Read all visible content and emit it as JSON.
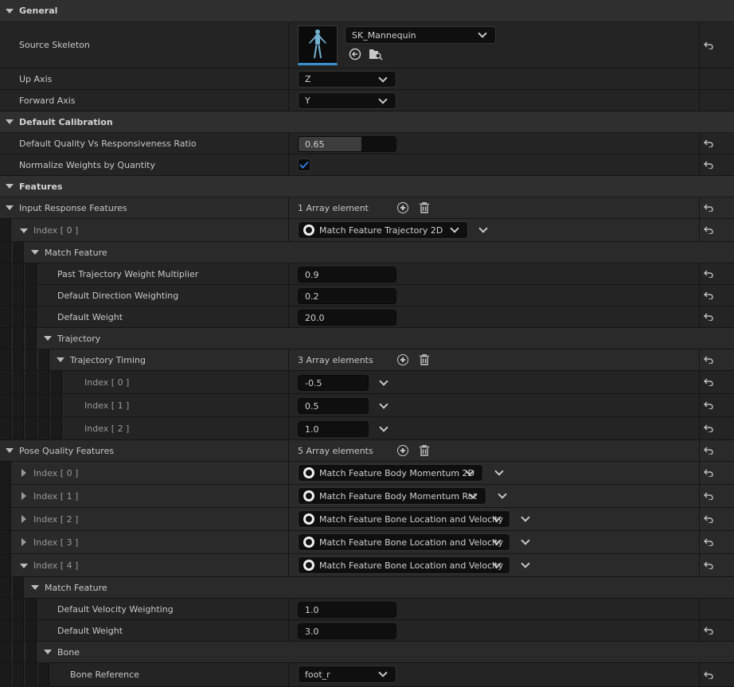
{
  "sections": {
    "general": "General",
    "default_calibration": "Default Calibration",
    "features": "Features"
  },
  "general": {
    "source_skeleton_label": "Source Skeleton",
    "source_skeleton_value": "SK_Mannequin",
    "up_axis_label": "Up Axis",
    "up_axis_value": "Z",
    "forward_axis_label": "Forward Axis",
    "forward_axis_value": "Y"
  },
  "calibration": {
    "ratio_label": "Default Quality Vs Responsiveness Ratio",
    "ratio_value": "0.65",
    "ratio_fraction": 0.65,
    "normalize_label": "Normalize Weights by Quantity",
    "normalize_checked": true
  },
  "input_response": {
    "label": "Input Response Features",
    "count": "1 Array element",
    "index0_label": "Index [ 0 ]",
    "index0_type": "Match Feature Trajectory 2D",
    "match_feature_label": "Match Feature",
    "past_traj_label": "Past Trajectory Weight Multiplier",
    "past_traj_value": "0.9",
    "dir_weighting_label": "Default Direction Weighting",
    "dir_weighting_value": "0.2",
    "default_weight_label": "Default Weight",
    "default_weight_value": "20.0",
    "trajectory_label": "Trajectory",
    "timing_label": "Trajectory Timing",
    "timing_count": "3 Array elements",
    "timing_items": [
      {
        "label": "Index [ 0 ]",
        "value": "-0.5"
      },
      {
        "label": "Index [ 1 ]",
        "value": "0.5"
      },
      {
        "label": "Index [ 2 ]",
        "value": "1.0"
      }
    ]
  },
  "pose_quality": {
    "label": "Pose Quality Features",
    "count": "5 Array elements",
    "items": [
      {
        "label": "Index [ 0 ]",
        "type": "Match Feature Body Momentum 2D"
      },
      {
        "label": "Index [ 1 ]",
        "type": "Match Feature Body Momentum Rot"
      },
      {
        "label": "Index [ 2 ]",
        "type": "Match Feature Bone Location and Velocity"
      },
      {
        "label": "Index [ 3 ]",
        "type": "Match Feature Bone Location and Velocity"
      },
      {
        "label": "Index [ 4 ]",
        "type": "Match Feature Bone Location and Velocity"
      }
    ],
    "match_feature_label": "Match Feature",
    "velocity_weighting_label": "Default Velocity Weighting",
    "velocity_weighting_value": "1.0",
    "default_weight_label": "Default Weight",
    "default_weight_value": "3.0",
    "bone_label": "Bone",
    "bone_ref_label": "Bone Reference",
    "bone_ref_value": "foot_r"
  },
  "colors": {
    "accent": "#3a8fd0",
    "checkbox": "#2a78d6"
  }
}
